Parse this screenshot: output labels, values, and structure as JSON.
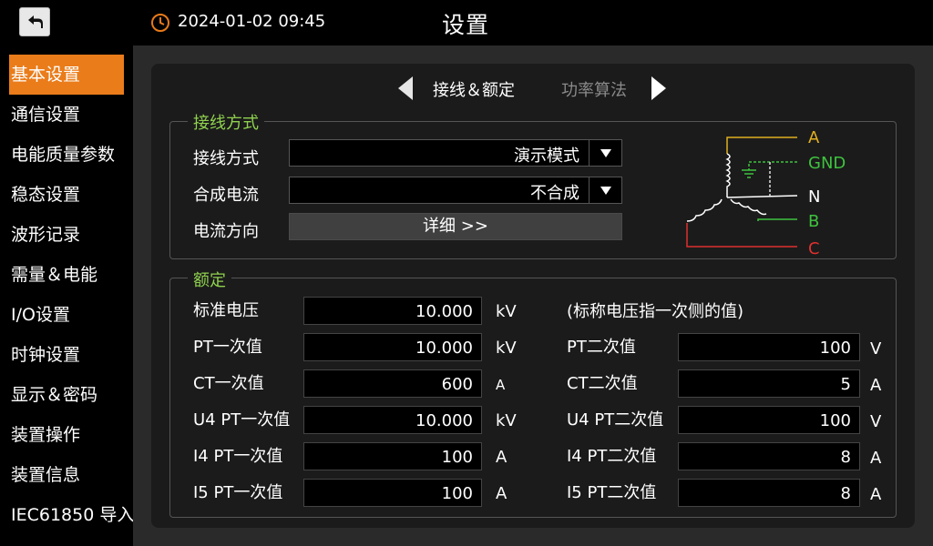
{
  "header": {
    "datetime": "2024-01-02 09:45",
    "title": "设置",
    "back_icon": "return-arrow-icon",
    "clock_icon": "clock-icon",
    "clock_color": "#e87a1a"
  },
  "sidebar": {
    "active_color": "#ea7c1a",
    "items": [
      {
        "label": "基本设置"
      },
      {
        "label": "通信设置"
      },
      {
        "label": "电能质量参数"
      },
      {
        "label": "稳态设置"
      },
      {
        "label": "波形记录"
      },
      {
        "label": "需量＆电能"
      },
      {
        "label": "I/O设置"
      },
      {
        "label": "时钟设置"
      },
      {
        "label": "显示＆密码"
      },
      {
        "label": "装置操作"
      },
      {
        "label": "装置信息"
      },
      {
        "label": "IEC61850 导入"
      }
    ]
  },
  "tabs": {
    "active": "接线＆额定",
    "inactive": "功率算法"
  },
  "wiring": {
    "title": "接线方式",
    "mode_label": "接线方式",
    "mode_value": "演示模式",
    "combine_label": "合成电流",
    "combine_value": "不合成",
    "direction_label": "电流方向",
    "direction_button": "详细 >>",
    "diagram": {
      "A": "A",
      "GND": "GND",
      "N": "N",
      "B": "B",
      "C": "C",
      "color_A": "#e0b020",
      "color_GND": "#3ec23e",
      "color_B": "#3ec23e",
      "color_C": "#e03030",
      "color_N": "#ffffff"
    }
  },
  "rated": {
    "title": "额定",
    "title_color": "#8fd14f",
    "note": "(标称电压指一次侧的值)",
    "left": [
      {
        "label": "标准电压",
        "value": "10.000",
        "unit": "kV"
      },
      {
        "label": "PT一次值",
        "value": "10.000",
        "unit": "kV"
      },
      {
        "label": "CT一次值",
        "value": "600",
        "unit": "A"
      },
      {
        "label": "U4 PT一次值",
        "value": "10.000",
        "unit": "kV"
      },
      {
        "label": "I4 PT一次值",
        "value": "100",
        "unit": "A"
      },
      {
        "label": "I5 PT一次值",
        "value": "100",
        "unit": "A"
      }
    ],
    "right": [
      {
        "label": "PT二次值",
        "value": "100",
        "unit": "V"
      },
      {
        "label": "CT二次值",
        "value": "5",
        "unit": "A"
      },
      {
        "label": "U4 PT二次值",
        "value": "100",
        "unit": "V"
      },
      {
        "label": "I4 PT二次值",
        "value": "8",
        "unit": "A"
      },
      {
        "label": "I5 PT二次值",
        "value": "8",
        "unit": "A"
      }
    ]
  }
}
